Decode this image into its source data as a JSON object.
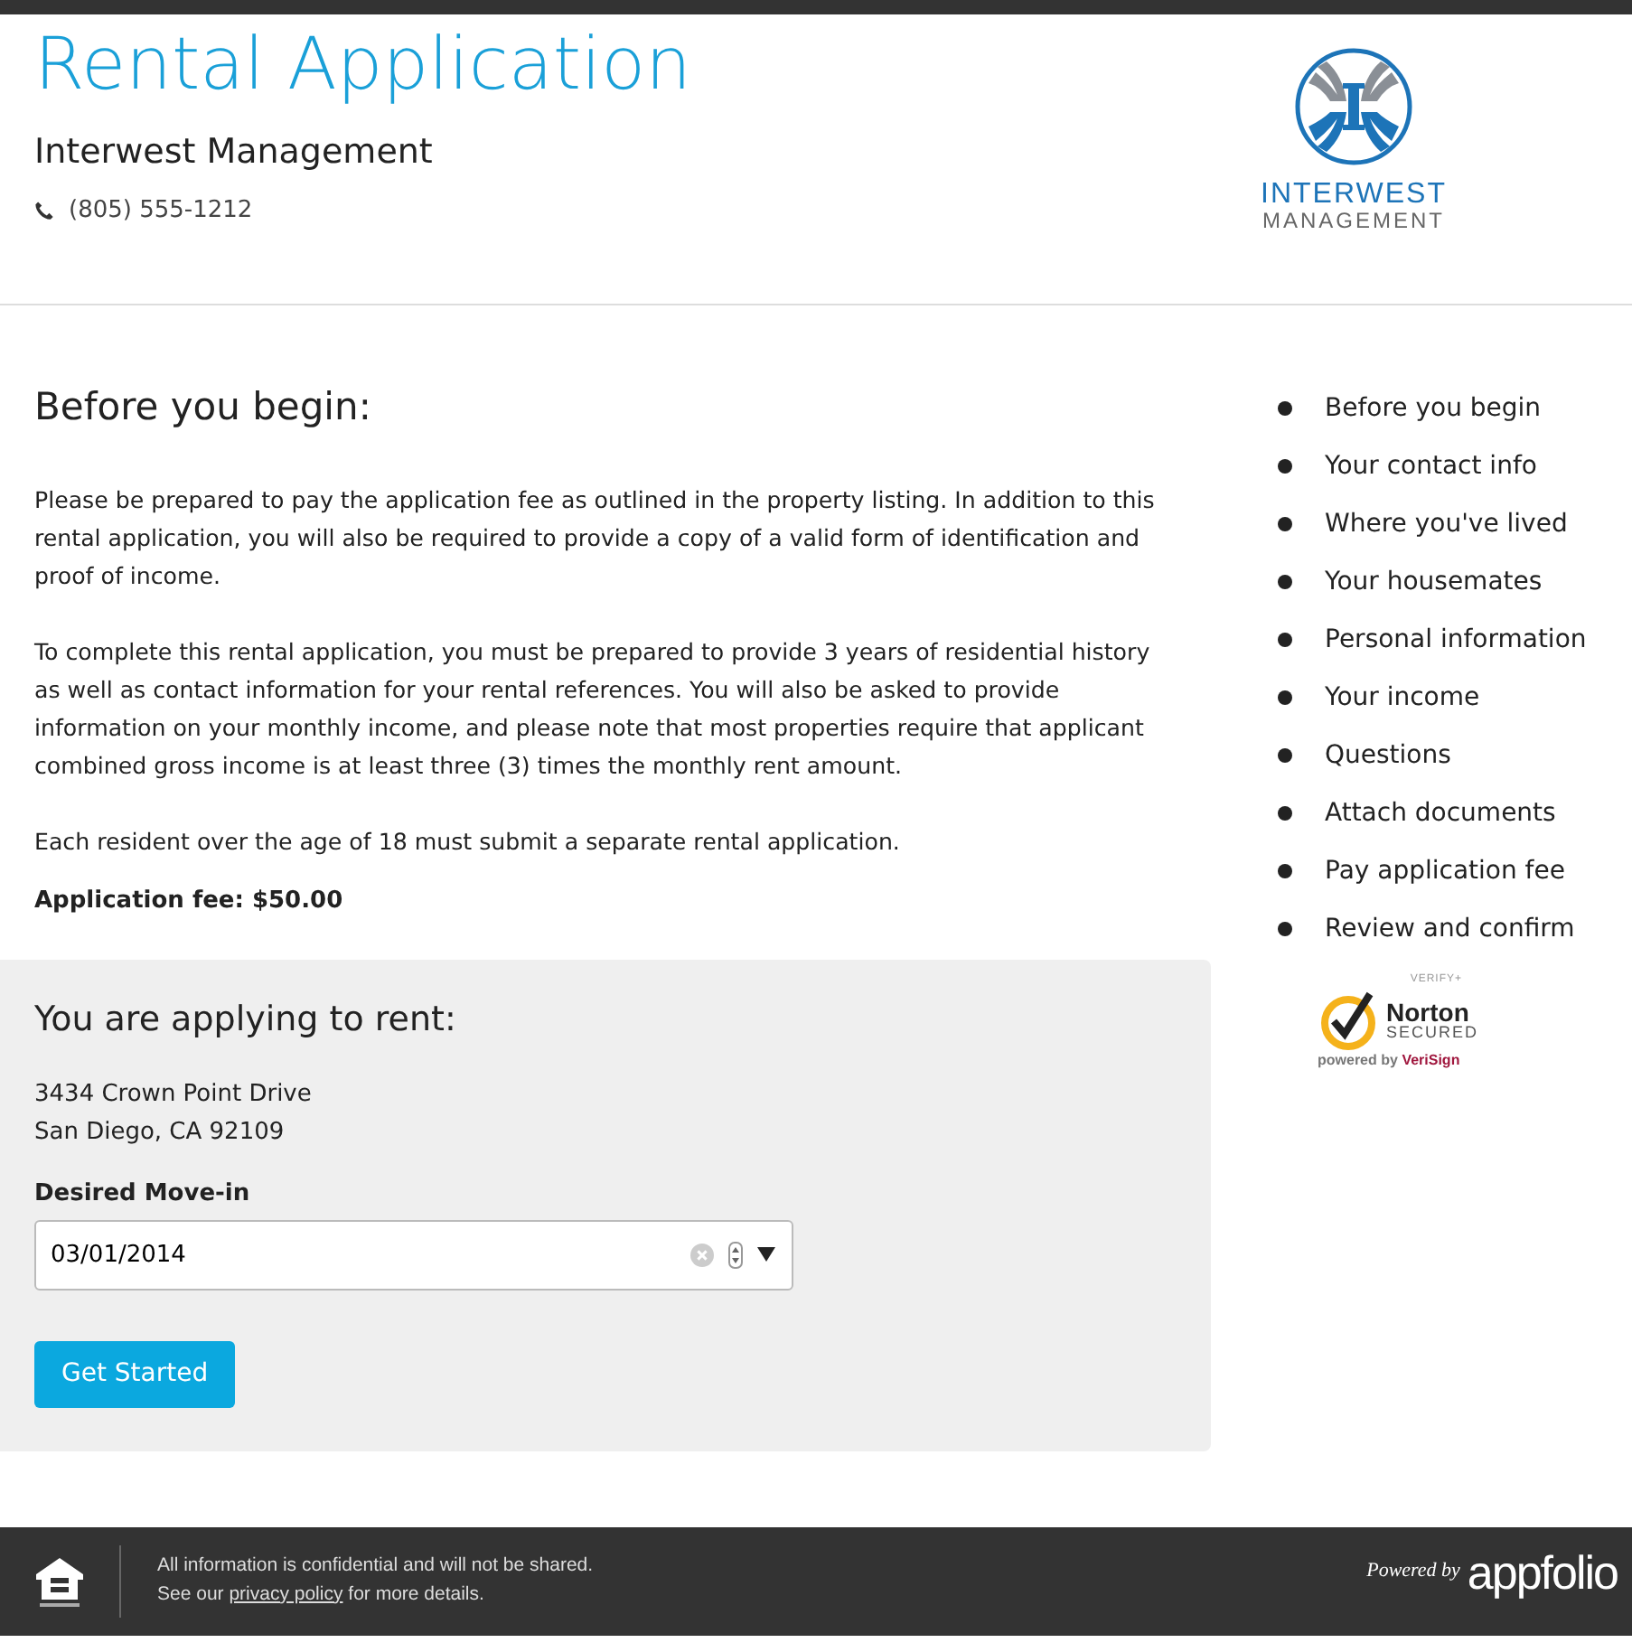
{
  "header": {
    "title": "Rental Application",
    "company": "Interwest Management",
    "phone": "(805) 555-1212",
    "logo": {
      "line_1": "INTERWEST",
      "line_2": "MANAGEMENT"
    }
  },
  "intro": {
    "heading": "Before you begin:",
    "paragraphs": [
      "Please be prepared to pay the application fee as outlined in the property listing. In addition to this rental application, you will also be required to provide a copy of a valid form of identification and proof of income.",
      "To complete this rental application, you must be prepared to provide 3 years of residential history as well as contact information for your rental references. You will also be asked to provide information on your monthly income, and please note that most properties require that applicant combined gross income is at least three (3) times the monthly rent amount.",
      "Each resident over the age of 18 must submit a separate rental application."
    ],
    "fee": "Application fee: $50.00"
  },
  "rent": {
    "heading": "You are applying to rent:",
    "address_lines": [
      "3434 Crown Point Drive",
      "San Diego, CA 92109"
    ],
    "move_in_label": "Desired Move-in",
    "move_in_value": "03/01/2014",
    "button": "Get Started"
  },
  "steps": [
    {
      "label": "Before you begin"
    },
    {
      "label": "Your contact info"
    },
    {
      "label": "Where you've lived"
    },
    {
      "label": "Your housemates"
    },
    {
      "label": "Personal information"
    },
    {
      "label": "Your income"
    },
    {
      "label": "Questions"
    },
    {
      "label": "Attach documents"
    },
    {
      "label": "Pay application fee"
    },
    {
      "label": "Review and confirm"
    }
  ],
  "norton": {
    "verify": "VERIFY+",
    "brand": "Norton",
    "secured": "SECURED",
    "powered_by": "powered by",
    "vendor": "VeriSign"
  },
  "footer": {
    "line_1": "All information is confidential and will not be shared.",
    "line_2_before": "See our",
    "link": "privacy policy",
    "line_2_after": "for more details.",
    "powered_by": "Powered by",
    "brand": "appfolio"
  }
}
